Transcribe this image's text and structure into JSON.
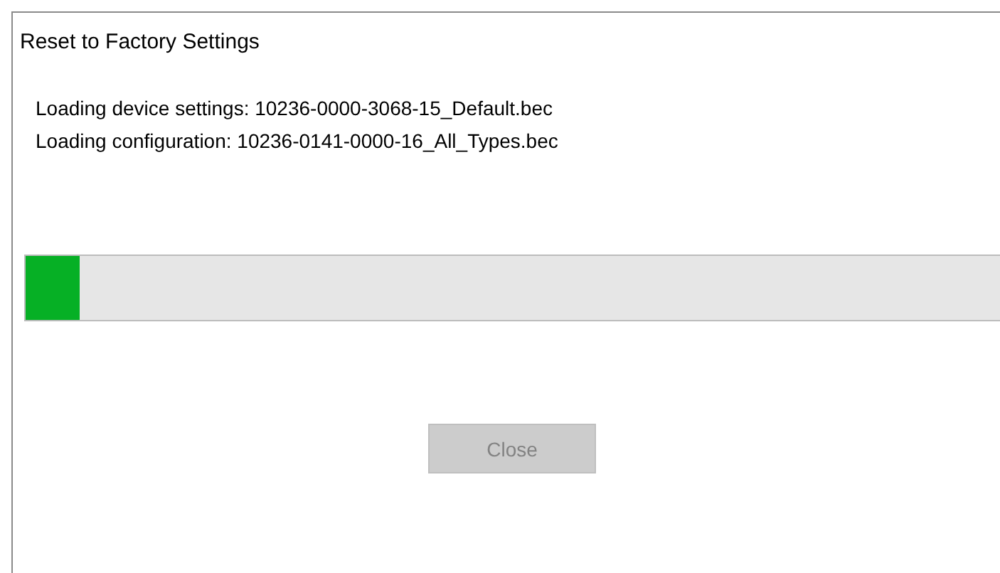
{
  "window": {
    "title": "Reset to Factory Settings"
  },
  "log_lines": [
    "Loading device settings: 10236-0000-3068-15_Default.bec",
    "Loading configuration: 10236-0141-0000-16_All_Types.bec"
  ],
  "progress": {
    "level": 0.055
  },
  "buttons": [
    {
      "label": "Close",
      "disabled": true
    }
  ]
}
